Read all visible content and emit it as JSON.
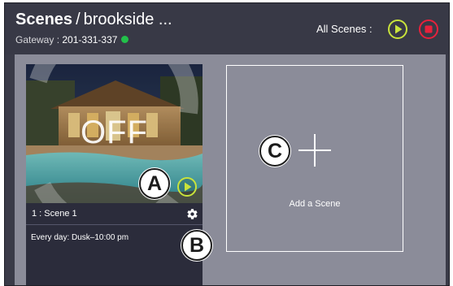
{
  "header": {
    "title": "Scenes",
    "separator": "/",
    "location": "brookside ...",
    "gateway_label": "Gateway :",
    "gateway_id": "201-331-337",
    "gateway_status_color": "#22c04a",
    "all_scenes_label": "All Scenes :",
    "play_all_icon": "play-circle-icon",
    "stop_all_icon": "stop-circle-icon",
    "play_color": "#c9e33b",
    "stop_color": "#e8213c"
  },
  "scenes": [
    {
      "state_label": "OFF",
      "name": "1 : Scene 1",
      "schedule": "Every day: Dusk–10:00 pm",
      "play_icon": "play-circle-icon",
      "settings_icon": "gear-icon"
    }
  ],
  "add_scene": {
    "label": "Add a Scene",
    "icon": "plus-icon"
  },
  "callouts": {
    "a": "A",
    "b": "B",
    "c": "C"
  },
  "colors": {
    "header_bg": "#383946",
    "content_bg": "#8b8c99",
    "card_bg": "#2b2c3b"
  }
}
